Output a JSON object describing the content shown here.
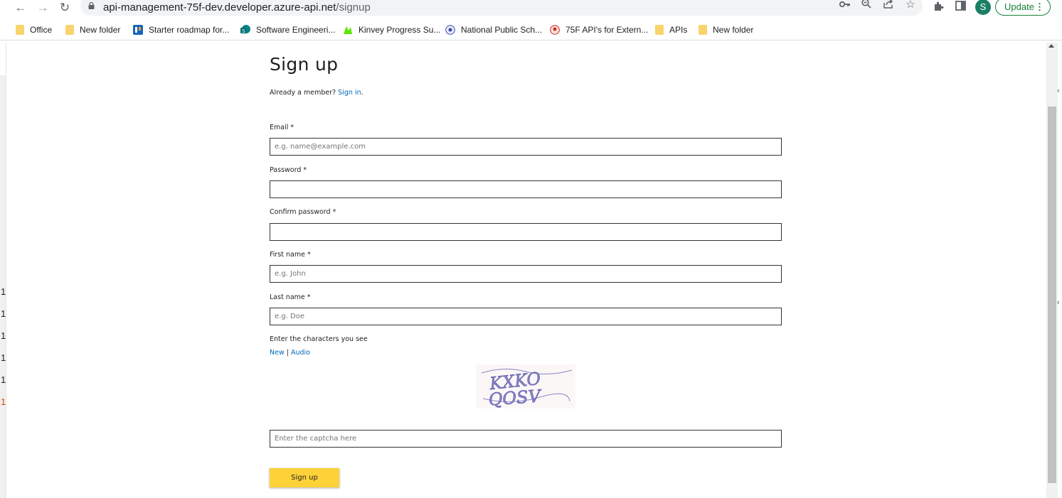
{
  "browser": {
    "url_host": "api-management-75f-dev.developer.azure-api.net",
    "url_path": "/signup",
    "avatar_letter": "S",
    "update_label": "Update"
  },
  "bookmarks": [
    {
      "label": "Office",
      "icon": "folder-icon"
    },
    {
      "label": "New folder",
      "icon": "folder-icon"
    },
    {
      "label": "Starter roadmap for...",
      "icon": "roadmap-icon"
    },
    {
      "label": "Software Engineeri...",
      "icon": "sharepoint-icon"
    },
    {
      "label": "Kinvey Progress Su...",
      "icon": "kinvey-icon"
    },
    {
      "label": "National Public Sch...",
      "icon": "school-icon"
    },
    {
      "label": "75F API's for Extern...",
      "icon": "75f-icon"
    },
    {
      "label": "APIs",
      "icon": "folder-icon"
    },
    {
      "label": "New folder",
      "icon": "folder-icon"
    }
  ],
  "form": {
    "title": "Sign up",
    "already_member": "Already a member? ",
    "sign_in_link": "Sign in",
    "period": ".",
    "email_label": "Email *",
    "email_placeholder": "e.g. name@example.com",
    "password_label": "Password *",
    "confirm_label": "Confirm password *",
    "first_label": "First name *",
    "first_placeholder": "e.g. John",
    "last_label": "Last name *",
    "last_placeholder": "e.g. Doe",
    "captcha_label": "Enter the characters you see",
    "captcha_new": "New",
    "captcha_sep": " | ",
    "captcha_audio": "Audio",
    "captcha_text": "KXKO QOSV",
    "captcha_placeholder": "Enter the captcha here",
    "submit_label": "Sign up"
  },
  "left_digits": [
    "1",
    "1",
    "1",
    "1",
    "1",
    "1"
  ],
  "colors": {
    "link": "#0067b8",
    "button": "#fdd238",
    "update": "#188038",
    "avatar": "#1a7f64"
  }
}
